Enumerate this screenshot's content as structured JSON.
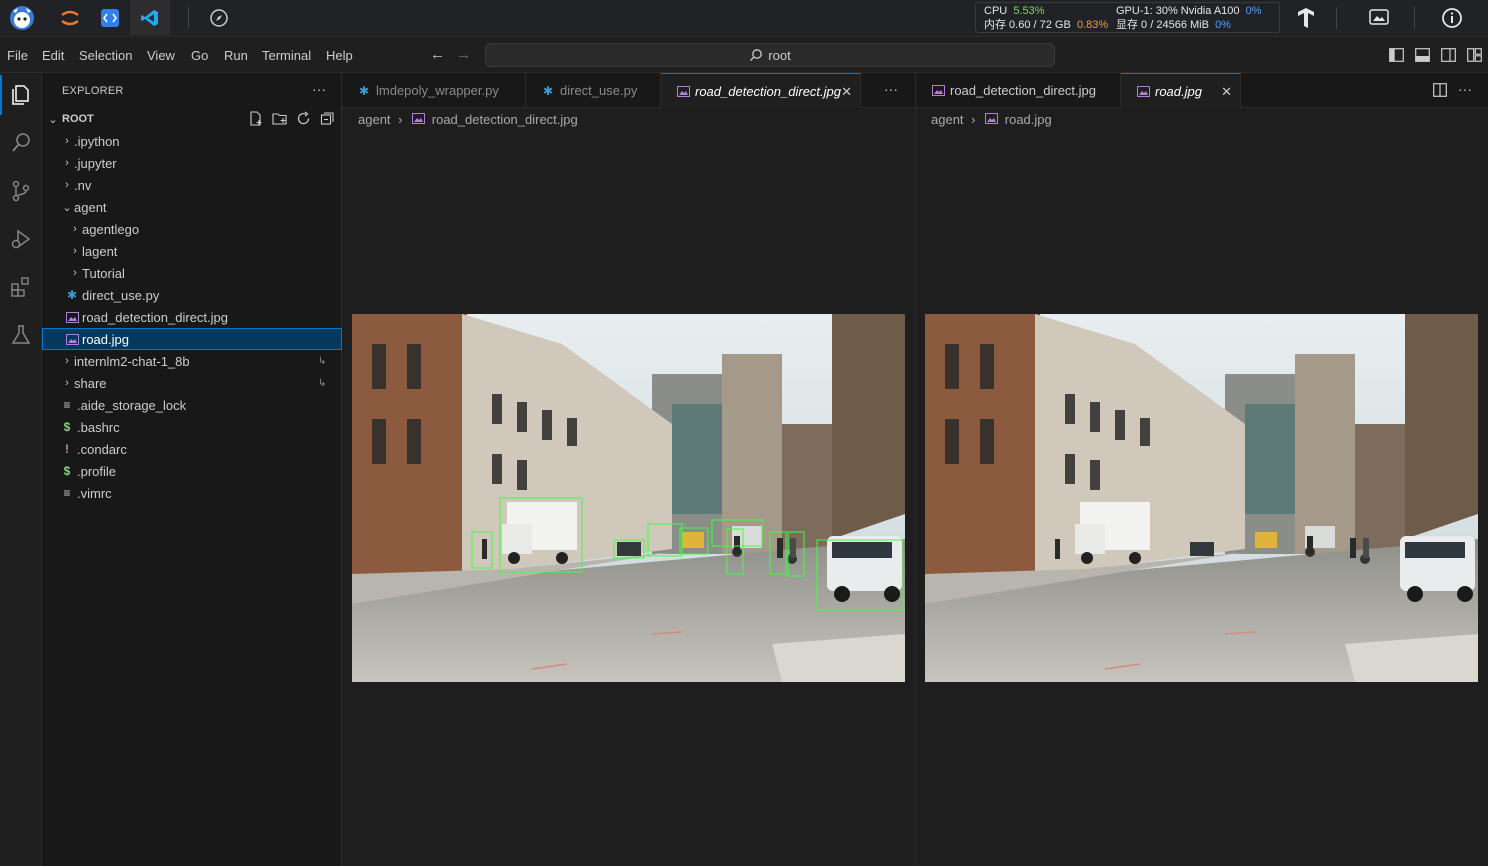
{
  "statusbar": {
    "cpu_label": "CPU",
    "cpu_percent": "5.53%",
    "mem_label": "内存 0.60 / 72 GB",
    "mem_percent": "0.83%",
    "gpu_label": "GPU-1: 30% Nvidia A100",
    "gpu_percent": "0%",
    "vram_label": "显存 0 / 24566 MiB",
    "vram_percent": "0%"
  },
  "menubar": {
    "items": [
      "File",
      "Edit",
      "Selection",
      "View",
      "Go",
      "Run",
      "Terminal",
      "Help"
    ],
    "search_text": "root"
  },
  "explorer": {
    "title": "EXPLORER",
    "root_label": "ROOT",
    "items": [
      {
        "label": ".ipython"
      },
      {
        "label": ".jupyter"
      },
      {
        "label": ".nv"
      },
      {
        "label": "agent"
      },
      {
        "label": "agentlego"
      },
      {
        "label": "lagent"
      },
      {
        "label": "Tutorial"
      },
      {
        "label": "direct_use.py"
      },
      {
        "label": "road_detection_direct.jpg"
      },
      {
        "label": "road.jpg"
      },
      {
        "label": "internlm2-chat-1_8b"
      },
      {
        "label": "share"
      },
      {
        "label": ".aide_storage_lock"
      },
      {
        "label": ".bashrc"
      },
      {
        "label": ".condarc"
      },
      {
        "label": ".profile"
      },
      {
        "label": ".vimrc"
      }
    ]
  },
  "editor_left": {
    "tabs": [
      {
        "label": "lmdepoly_wrapper.py"
      },
      {
        "label": "direct_use.py"
      },
      {
        "label": "road_detection_direct.jpg"
      }
    ],
    "breadcrumb_folder": "agent",
    "breadcrumb_file": "road_detection_direct.jpg"
  },
  "editor_right": {
    "tabs": [
      {
        "label": "road_detection_direct.jpg"
      },
      {
        "label": "road.jpg"
      }
    ],
    "breadcrumb_folder": "agent",
    "breadcrumb_file": "road.jpg"
  },
  "colors": {
    "accent": "#0078d4",
    "detection_box": "#3cff3c",
    "selection": "#04395e"
  }
}
